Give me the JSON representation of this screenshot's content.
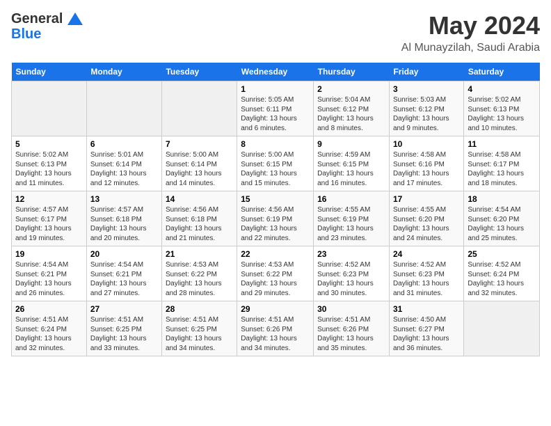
{
  "header": {
    "logo_line1": "General",
    "logo_line2": "Blue",
    "main_title": "May 2024",
    "subtitle": "Al Munayzilah, Saudi Arabia"
  },
  "days_of_week": [
    "Sunday",
    "Monday",
    "Tuesday",
    "Wednesday",
    "Thursday",
    "Friday",
    "Saturday"
  ],
  "weeks": [
    [
      {
        "num": "",
        "info": ""
      },
      {
        "num": "",
        "info": ""
      },
      {
        "num": "",
        "info": ""
      },
      {
        "num": "1",
        "info": "Sunrise: 5:05 AM\nSunset: 6:11 PM\nDaylight: 13 hours and 6 minutes."
      },
      {
        "num": "2",
        "info": "Sunrise: 5:04 AM\nSunset: 6:12 PM\nDaylight: 13 hours and 8 minutes."
      },
      {
        "num": "3",
        "info": "Sunrise: 5:03 AM\nSunset: 6:12 PM\nDaylight: 13 hours and 9 minutes."
      },
      {
        "num": "4",
        "info": "Sunrise: 5:02 AM\nSunset: 6:13 PM\nDaylight: 13 hours and 10 minutes."
      }
    ],
    [
      {
        "num": "5",
        "info": "Sunrise: 5:02 AM\nSunset: 6:13 PM\nDaylight: 13 hours and 11 minutes."
      },
      {
        "num": "6",
        "info": "Sunrise: 5:01 AM\nSunset: 6:14 PM\nDaylight: 13 hours and 12 minutes."
      },
      {
        "num": "7",
        "info": "Sunrise: 5:00 AM\nSunset: 6:14 PM\nDaylight: 13 hours and 14 minutes."
      },
      {
        "num": "8",
        "info": "Sunrise: 5:00 AM\nSunset: 6:15 PM\nDaylight: 13 hours and 15 minutes."
      },
      {
        "num": "9",
        "info": "Sunrise: 4:59 AM\nSunset: 6:15 PM\nDaylight: 13 hours and 16 minutes."
      },
      {
        "num": "10",
        "info": "Sunrise: 4:58 AM\nSunset: 6:16 PM\nDaylight: 13 hours and 17 minutes."
      },
      {
        "num": "11",
        "info": "Sunrise: 4:58 AM\nSunset: 6:17 PM\nDaylight: 13 hours and 18 minutes."
      }
    ],
    [
      {
        "num": "12",
        "info": "Sunrise: 4:57 AM\nSunset: 6:17 PM\nDaylight: 13 hours and 19 minutes."
      },
      {
        "num": "13",
        "info": "Sunrise: 4:57 AM\nSunset: 6:18 PM\nDaylight: 13 hours and 20 minutes."
      },
      {
        "num": "14",
        "info": "Sunrise: 4:56 AM\nSunset: 6:18 PM\nDaylight: 13 hours and 21 minutes."
      },
      {
        "num": "15",
        "info": "Sunrise: 4:56 AM\nSunset: 6:19 PM\nDaylight: 13 hours and 22 minutes."
      },
      {
        "num": "16",
        "info": "Sunrise: 4:55 AM\nSunset: 6:19 PM\nDaylight: 13 hours and 23 minutes."
      },
      {
        "num": "17",
        "info": "Sunrise: 4:55 AM\nSunset: 6:20 PM\nDaylight: 13 hours and 24 minutes."
      },
      {
        "num": "18",
        "info": "Sunrise: 4:54 AM\nSunset: 6:20 PM\nDaylight: 13 hours and 25 minutes."
      }
    ],
    [
      {
        "num": "19",
        "info": "Sunrise: 4:54 AM\nSunset: 6:21 PM\nDaylight: 13 hours and 26 minutes."
      },
      {
        "num": "20",
        "info": "Sunrise: 4:54 AM\nSunset: 6:21 PM\nDaylight: 13 hours and 27 minutes."
      },
      {
        "num": "21",
        "info": "Sunrise: 4:53 AM\nSunset: 6:22 PM\nDaylight: 13 hours and 28 minutes."
      },
      {
        "num": "22",
        "info": "Sunrise: 4:53 AM\nSunset: 6:22 PM\nDaylight: 13 hours and 29 minutes."
      },
      {
        "num": "23",
        "info": "Sunrise: 4:52 AM\nSunset: 6:23 PM\nDaylight: 13 hours and 30 minutes."
      },
      {
        "num": "24",
        "info": "Sunrise: 4:52 AM\nSunset: 6:23 PM\nDaylight: 13 hours and 31 minutes."
      },
      {
        "num": "25",
        "info": "Sunrise: 4:52 AM\nSunset: 6:24 PM\nDaylight: 13 hours and 32 minutes."
      }
    ],
    [
      {
        "num": "26",
        "info": "Sunrise: 4:51 AM\nSunset: 6:24 PM\nDaylight: 13 hours and 32 minutes."
      },
      {
        "num": "27",
        "info": "Sunrise: 4:51 AM\nSunset: 6:25 PM\nDaylight: 13 hours and 33 minutes."
      },
      {
        "num": "28",
        "info": "Sunrise: 4:51 AM\nSunset: 6:25 PM\nDaylight: 13 hours and 34 minutes."
      },
      {
        "num": "29",
        "info": "Sunrise: 4:51 AM\nSunset: 6:26 PM\nDaylight: 13 hours and 34 minutes."
      },
      {
        "num": "30",
        "info": "Sunrise: 4:51 AM\nSunset: 6:26 PM\nDaylight: 13 hours and 35 minutes."
      },
      {
        "num": "31",
        "info": "Sunrise: 4:50 AM\nSunset: 6:27 PM\nDaylight: 13 hours and 36 minutes."
      },
      {
        "num": "",
        "info": ""
      }
    ]
  ]
}
